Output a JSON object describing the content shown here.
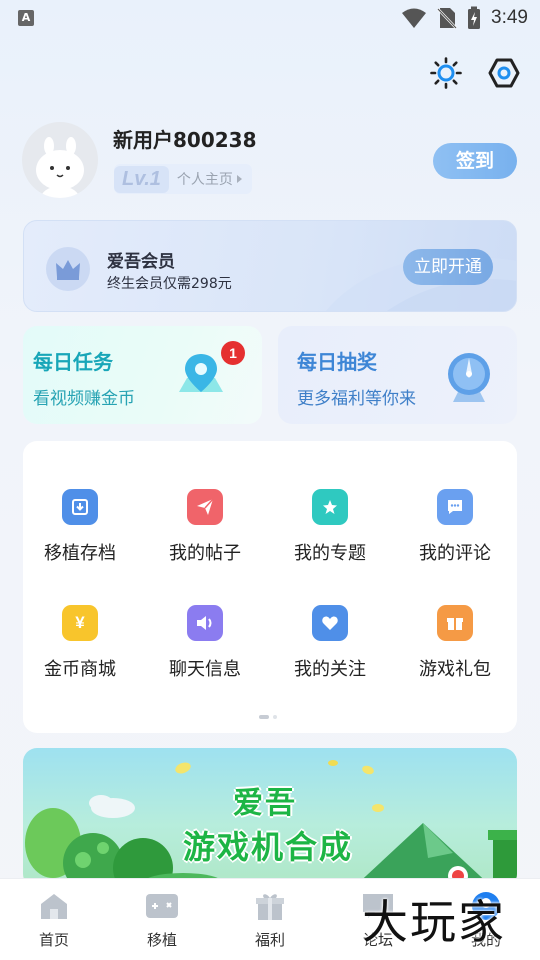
{
  "status_bar": {
    "time": "3:49",
    "left_glyph": "A"
  },
  "top_actions": {
    "brightness_icon": "sun-icon",
    "settings_icon": "hexagon-settings-icon"
  },
  "profile": {
    "username": "新用户800238",
    "level": "Lv.1",
    "homepage_link": "个人主页",
    "signin_label": "签到"
  },
  "vip": {
    "title": "爱吾会员",
    "subtitle": "终生会员仅需298元",
    "button": "立即开通"
  },
  "tasks": {
    "daily_task": {
      "title": "每日任务",
      "subtitle": "看视频赚金币",
      "badge": "1"
    },
    "daily_lottery": {
      "title": "每日抽奖",
      "subtitle": "更多福利等你来"
    }
  },
  "grid": {
    "items": [
      {
        "label": "移植存档",
        "icon": "download-box-icon",
        "color": "#4f8fe8"
      },
      {
        "label": "我的帖子",
        "icon": "paper-plane-icon",
        "color": "#f0646a"
      },
      {
        "label": "我的专题",
        "icon": "star-badge-icon",
        "color": "#2fc9c0"
      },
      {
        "label": "我的评论",
        "icon": "chat-bubble-icon",
        "color": "#6aa0f0"
      },
      {
        "label": "金币商城",
        "icon": "yen-coin-icon",
        "color": "#f8c52c"
      },
      {
        "label": "聊天信息",
        "icon": "speaker-icon",
        "color": "#8b7cf0"
      },
      {
        "label": "我的关注",
        "icon": "heart-icon",
        "color": "#4f8fe8"
      },
      {
        "label": "游戏礼包",
        "icon": "gift-box-icon",
        "color": "#f59a45"
      }
    ]
  },
  "banner": {
    "line1": "爱吾",
    "line2": "游戏机合成"
  },
  "bottom_nav": {
    "items": [
      {
        "label": "首页",
        "icon": "home-icon"
      },
      {
        "label": "移植",
        "icon": "gamepad-icon"
      },
      {
        "label": "福利",
        "icon": "gift-icon"
      },
      {
        "label": "论坛",
        "icon": "forum-icon"
      },
      {
        "label": "我的",
        "icon": "profile-icon"
      }
    ]
  },
  "watermark": "大玩家"
}
